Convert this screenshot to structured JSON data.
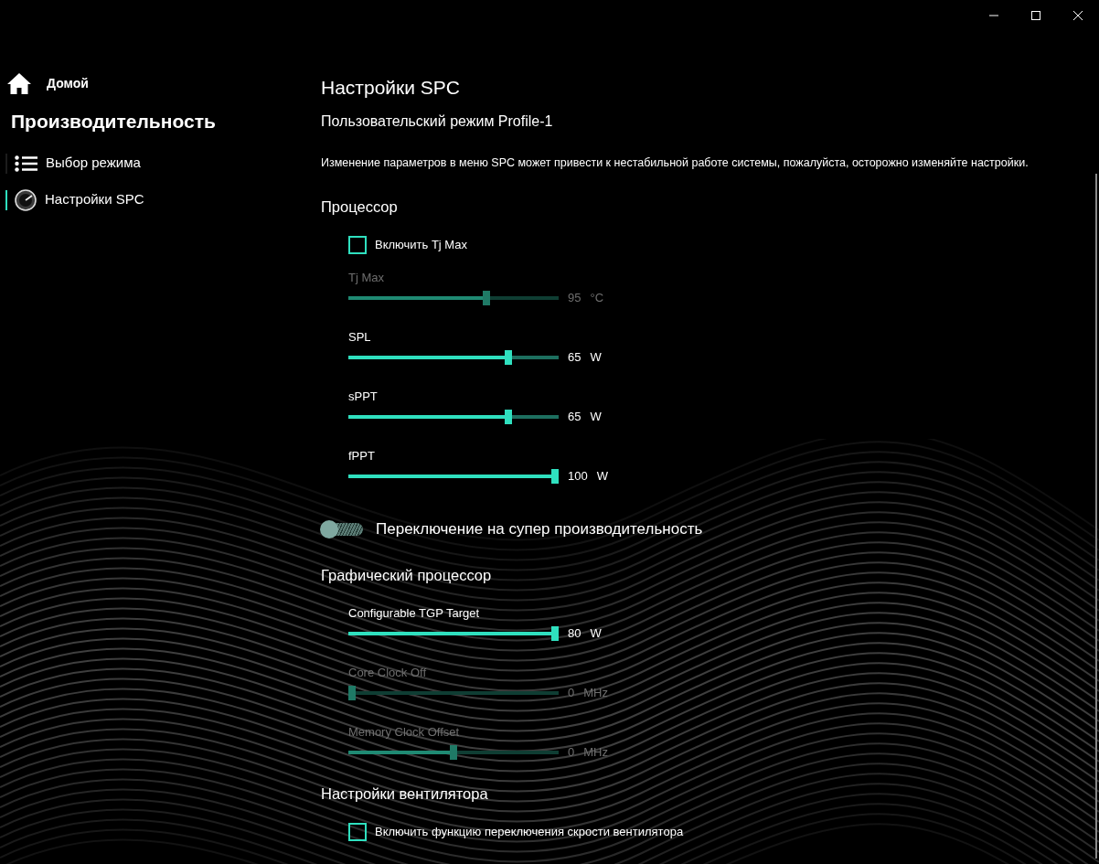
{
  "window": {
    "controls": [
      {
        "kind": "minimize"
      },
      {
        "kind": "maximize"
      },
      {
        "kind": "close"
      }
    ]
  },
  "sidebar": {
    "home": "Домой",
    "section": "Производительность",
    "items": [
      {
        "label": "Выбор режима",
        "kind": "list",
        "selected": false
      },
      {
        "label": "Настройки SPC",
        "kind": "gauge",
        "selected": true
      }
    ]
  },
  "page": {
    "title": "Настройки SPC",
    "subtitle": "Пользовательский режим Profile-1",
    "warning": "Изменение параметров в меню SPC может привести к нестабильной работе системы, пожалуйста, осторожно изменяйте настройки.",
    "sections": [
      {
        "heading": "Процессор",
        "controls": [
          {
            "kind": "checkbox",
            "label": "Включить Tj Max",
            "checked": false
          },
          {
            "kind": "slider",
            "label": "Tj Max",
            "level": 0.66,
            "value": "95",
            "unit": "°C",
            "disabled": true
          },
          {
            "kind": "slider",
            "label": "SPL",
            "level": 0.77,
            "value": "65",
            "unit": "W",
            "disabled": false
          },
          {
            "kind": "slider",
            "label": "sPPT",
            "level": 0.77,
            "value": "65",
            "unit": "W",
            "disabled": false
          },
          {
            "kind": "slider",
            "label": "fPPT",
            "level": 1,
            "value": "100",
            "unit": "W",
            "disabled": false
          },
          {
            "kind": "switch",
            "label": "Переключение на супер производительность",
            "on": false
          }
        ]
      },
      {
        "heading": "Графический процессор",
        "controls": [
          {
            "kind": "slider",
            "label": "Configurable TGP Target",
            "level": 1,
            "value": "80",
            "unit": "W",
            "disabled": false
          },
          {
            "kind": "slider",
            "label": "Core Clock Off",
            "level": 0,
            "value": "0",
            "unit": "MHz",
            "disabled": true
          },
          {
            "kind": "slider",
            "label": "Memory Clock Offset",
            "level": 0.5,
            "value": "0",
            "unit": "MHz",
            "disabled": true
          }
        ]
      },
      {
        "heading": "Настройки вентилятора",
        "controls": [
          {
            "kind": "checkbox",
            "label": "Включить функцию переключения скрости вентилятора",
            "checked": false
          }
        ]
      }
    ]
  }
}
